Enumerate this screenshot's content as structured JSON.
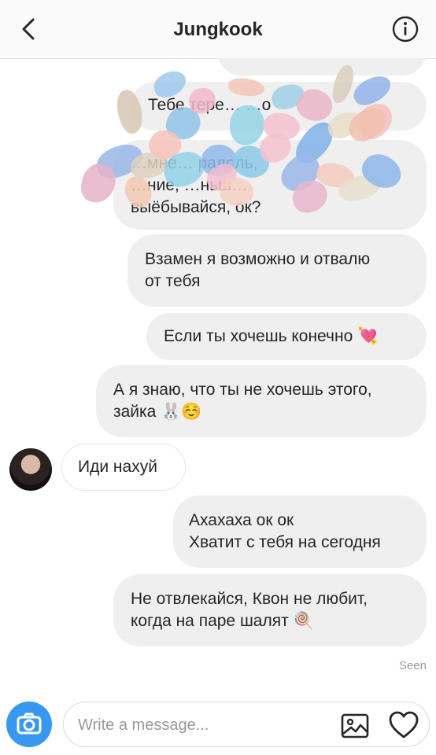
{
  "header": {
    "title": "Jungkook",
    "back_icon": "chevron-left-icon",
    "info_icon": "info-circle-icon"
  },
  "messages": [
    {
      "side": "out",
      "text": "Тебе тере… …о"
    },
    {
      "side": "out",
      "text": "…мне… радоль,\n…ние, …ньш…\nвыёбывайся, ок?"
    },
    {
      "side": "out",
      "text": "Взамен я возможно и отвалю\nот тебя"
    },
    {
      "side": "out",
      "text": "Если ты хочешь конечно 💘"
    },
    {
      "side": "out",
      "text": "А я знаю, что ты не хочешь этого,\nзайка 🐰☺️"
    },
    {
      "side": "in",
      "text": "Иди нахуй"
    },
    {
      "side": "out",
      "text": "Ахахаха ок ок\nХватит с тебя на сегодня"
    },
    {
      "side": "out",
      "text": "Не отвлекайся, Квон не любит,\nкогда на паре шалят 🍭"
    }
  ],
  "status": {
    "seen": "Seen"
  },
  "composer": {
    "placeholder": "Write a message...",
    "camera_icon": "camera-icon",
    "gallery_icon": "image-icon",
    "like_icon": "heart-icon"
  },
  "colors": {
    "accent": "#3897f0",
    "bubble_out": "#efefef",
    "text": "#262626"
  }
}
